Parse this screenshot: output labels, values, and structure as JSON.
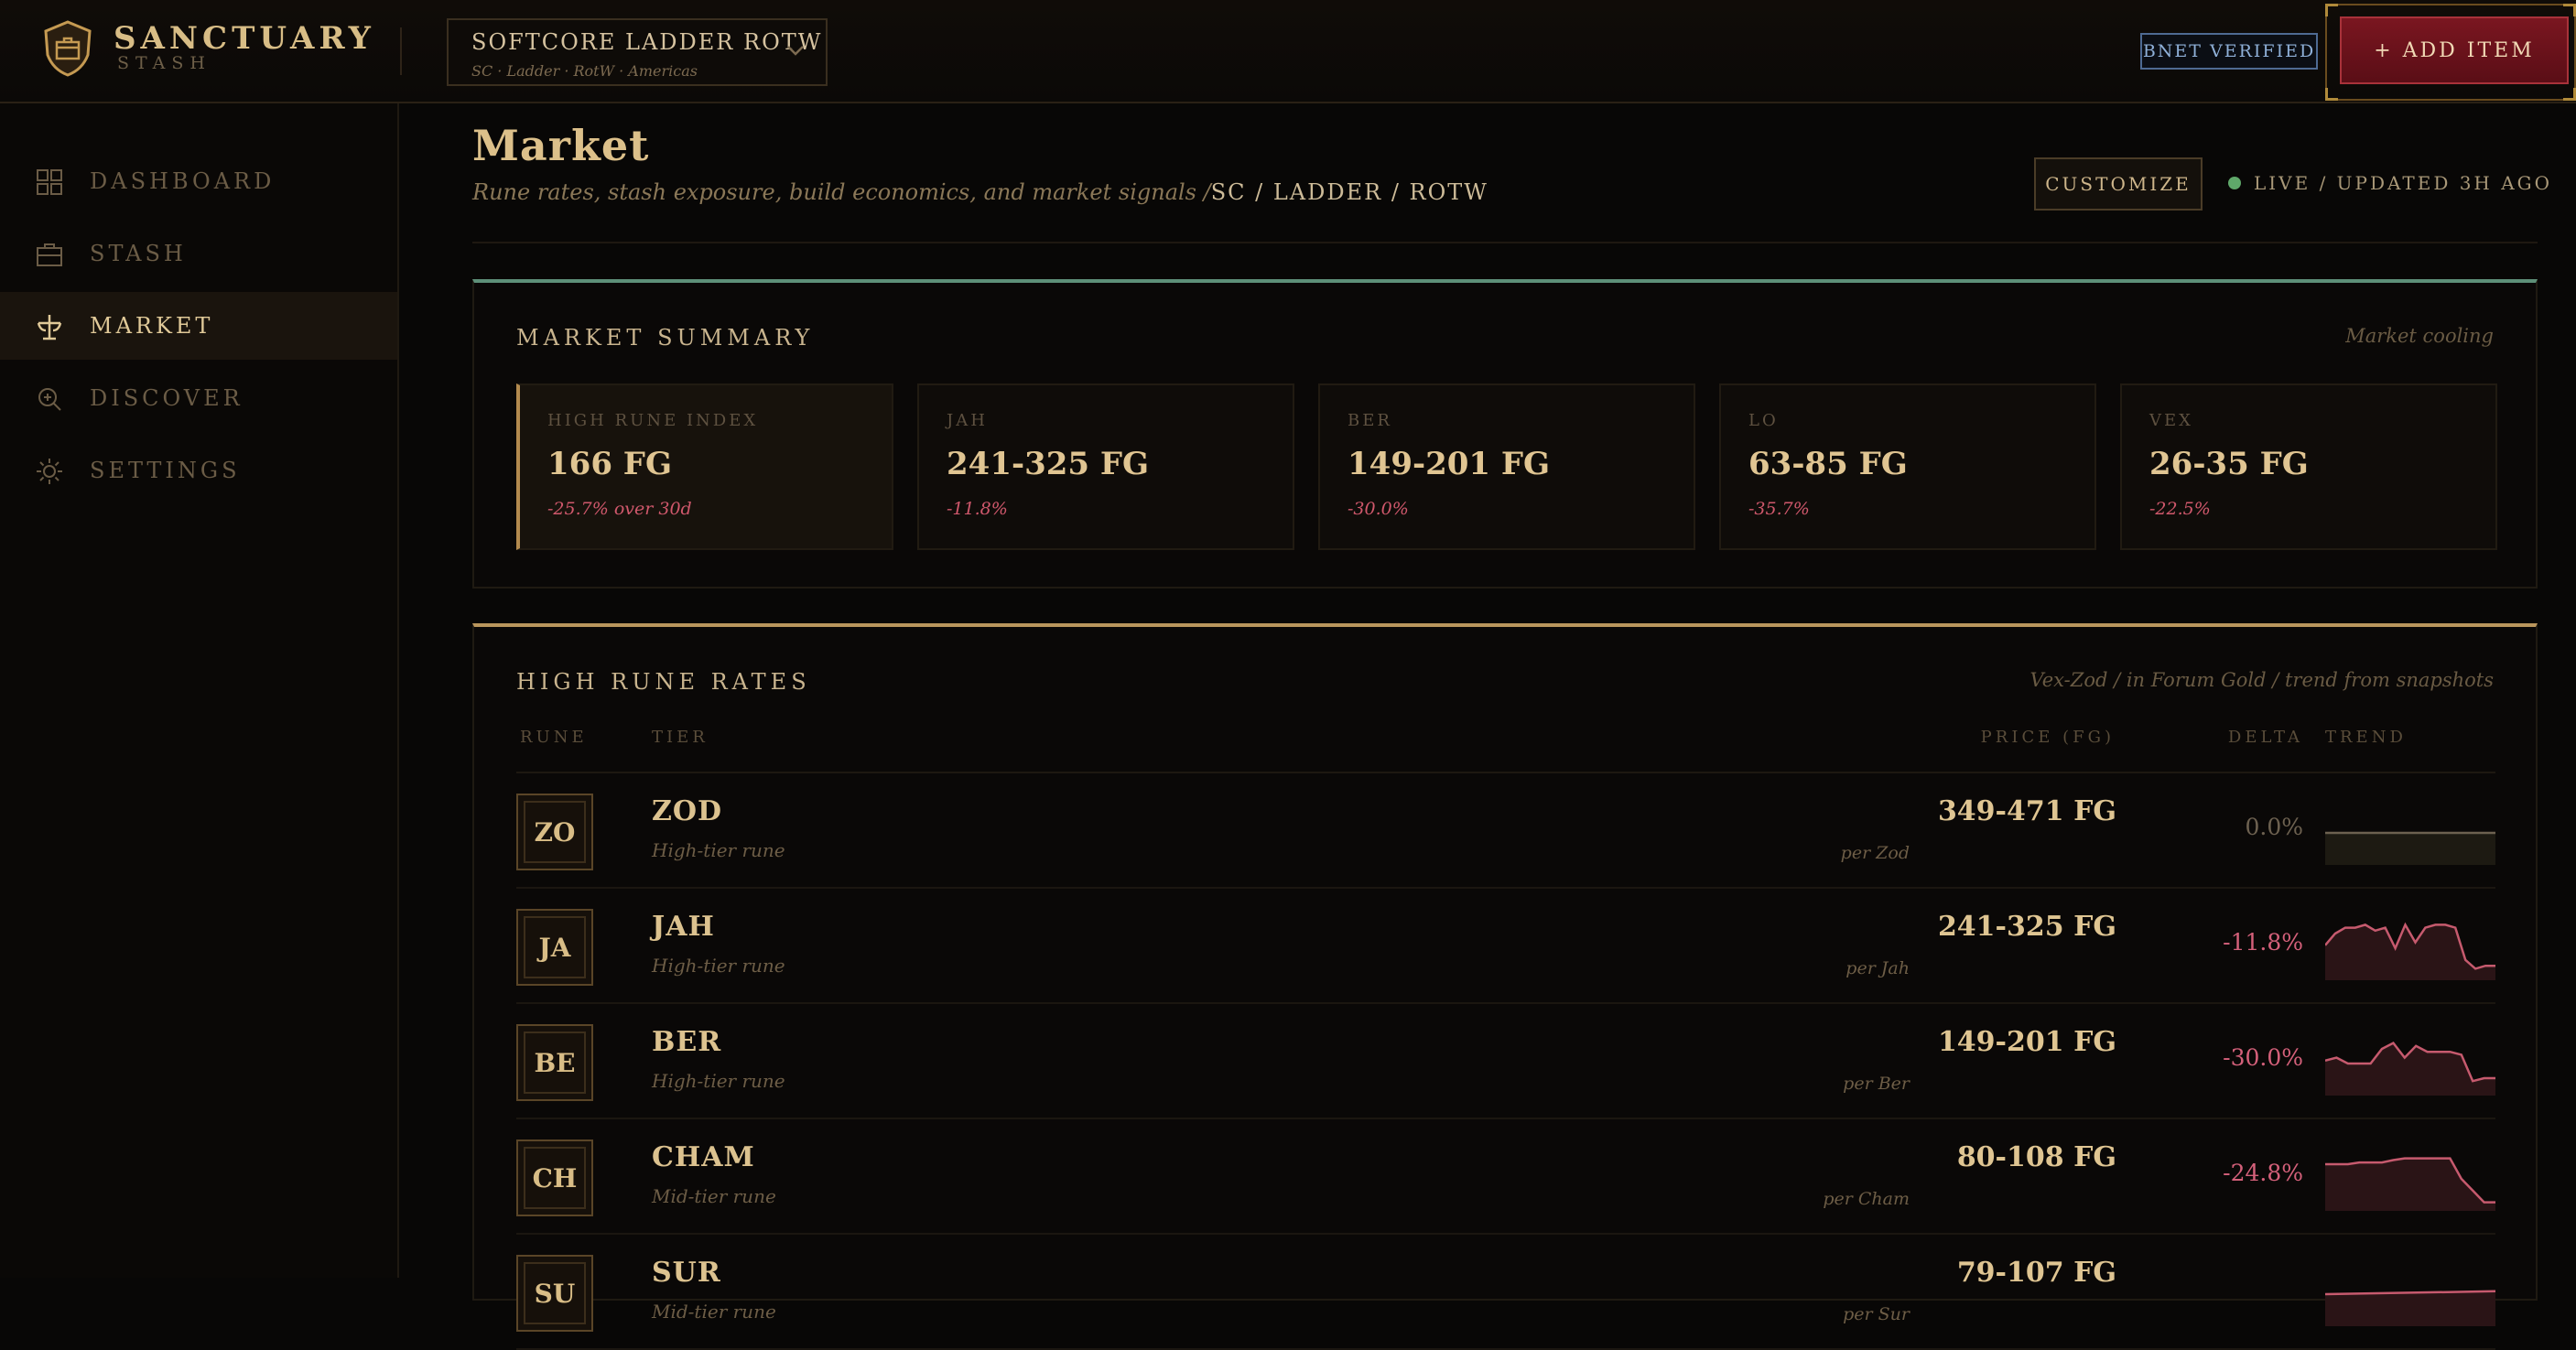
{
  "brand": {
    "title": "SANCTUARY",
    "subtitle": "STASH"
  },
  "realm": {
    "name": "SOFTCORE LADDER ROTW",
    "details": "SC · Ladder · RotW · Americas"
  },
  "header": {
    "bnet_badge": "BNET VERIFIED",
    "add_item_label": "+ ADD ITEM"
  },
  "sidebar": {
    "items": [
      {
        "label": "DASHBOARD",
        "icon": "grid-icon",
        "active": false
      },
      {
        "label": "STASH",
        "icon": "briefcase-icon",
        "active": false
      },
      {
        "label": "MARKET",
        "icon": "scales-icon",
        "active": true
      },
      {
        "label": "DISCOVER",
        "icon": "magnifier-icon",
        "active": false
      },
      {
        "label": "SETTINGS",
        "icon": "gear-icon",
        "active": false
      }
    ]
  },
  "page": {
    "title": "Market",
    "subtitle": "Rune rates, stash exposure, build economics, and market signals /",
    "breadcrumb": "SC / LADDER / ROTW",
    "customize_label": "CUSTOMIZE",
    "live_status": "LIVE / UPDATED 3H AGO"
  },
  "summary": {
    "title": "MARKET SUMMARY",
    "note": "Market cooling",
    "cards": [
      {
        "label": "HIGH RUNE INDEX",
        "value": "166 FG",
        "delta": "-25.7% over 30d"
      },
      {
        "label": "JAH",
        "value": "241-325 FG",
        "delta": "-11.8%"
      },
      {
        "label": "BER",
        "value": "149-201 FG",
        "delta": "-30.0%"
      },
      {
        "label": "LO",
        "value": "63-85 FG",
        "delta": "-35.7%"
      },
      {
        "label": "VEX",
        "value": "26-35 FG",
        "delta": "-22.5%"
      }
    ]
  },
  "rates": {
    "title": "HIGH RUNE RATES",
    "note": "Vex-Zod / in Forum Gold / trend from snapshots",
    "columns": {
      "rune": "RUNE",
      "tier": "TIER",
      "price": "PRICE (FG)",
      "delta": "DELTA",
      "trend": "TREND"
    },
    "rows": [
      {
        "abbr": "ZO",
        "name": "ZOD",
        "tier": "High-tier rune",
        "price": "349-471 FG",
        "per": "per Zod",
        "delta": "0.0%",
        "trend": [
          0.5,
          0.5,
          0.5,
          0.5,
          0.5,
          0.5,
          0.5,
          0.5,
          0.5,
          0.5,
          0.5,
          0.5,
          0.5,
          0.5,
          0.5,
          0.5,
          0.5,
          0.5,
          0.5,
          0.5
        ]
      },
      {
        "abbr": "JA",
        "name": "JAH",
        "tier": "High-tier rune",
        "price": "241-325 FG",
        "per": "per Jah",
        "delta": "-11.8%",
        "trend": [
          0.55,
          0.75,
          0.85,
          0.85,
          0.9,
          0.8,
          0.85,
          0.5,
          0.9,
          0.6,
          0.85,
          0.9,
          0.9,
          0.85,
          0.3,
          0.15,
          0.2,
          0.2
        ]
      },
      {
        "abbr": "BE",
        "name": "BER",
        "tier": "High-tier rune",
        "price": "149-201 FG",
        "per": "per Ber",
        "delta": "-30.0%",
        "trend": [
          0.55,
          0.6,
          0.5,
          0.5,
          0.5,
          0.75,
          0.85,
          0.6,
          0.8,
          0.7,
          0.7,
          0.7,
          0.65,
          0.2,
          0.25,
          0.25
        ]
      },
      {
        "abbr": "CH",
        "name": "CHAM",
        "tier": "Mid-tier rune",
        "price": "80-108 FG",
        "per": "per Cham",
        "delta": "-24.8%",
        "trend": [
          0.75,
          0.75,
          0.75,
          0.78,
          0.78,
          0.78,
          0.82,
          0.85,
          0.85,
          0.85,
          0.85,
          0.85,
          0.5,
          0.3,
          0.1,
          0.1
        ]
      },
      {
        "abbr": "SU",
        "name": "SUR",
        "tier": "Mid-tier rune",
        "price": "79-107 FG",
        "per": "per Sur",
        "delta": "",
        "trend": [
          0.5,
          0.55
        ]
      }
    ]
  },
  "colors": {
    "accent_gold": "#cdb58a",
    "delta_negative": "#d4607a",
    "summary_accent": "#5d8f78",
    "add_item_red": "#7a1620",
    "live_green": "#5fa86a"
  }
}
